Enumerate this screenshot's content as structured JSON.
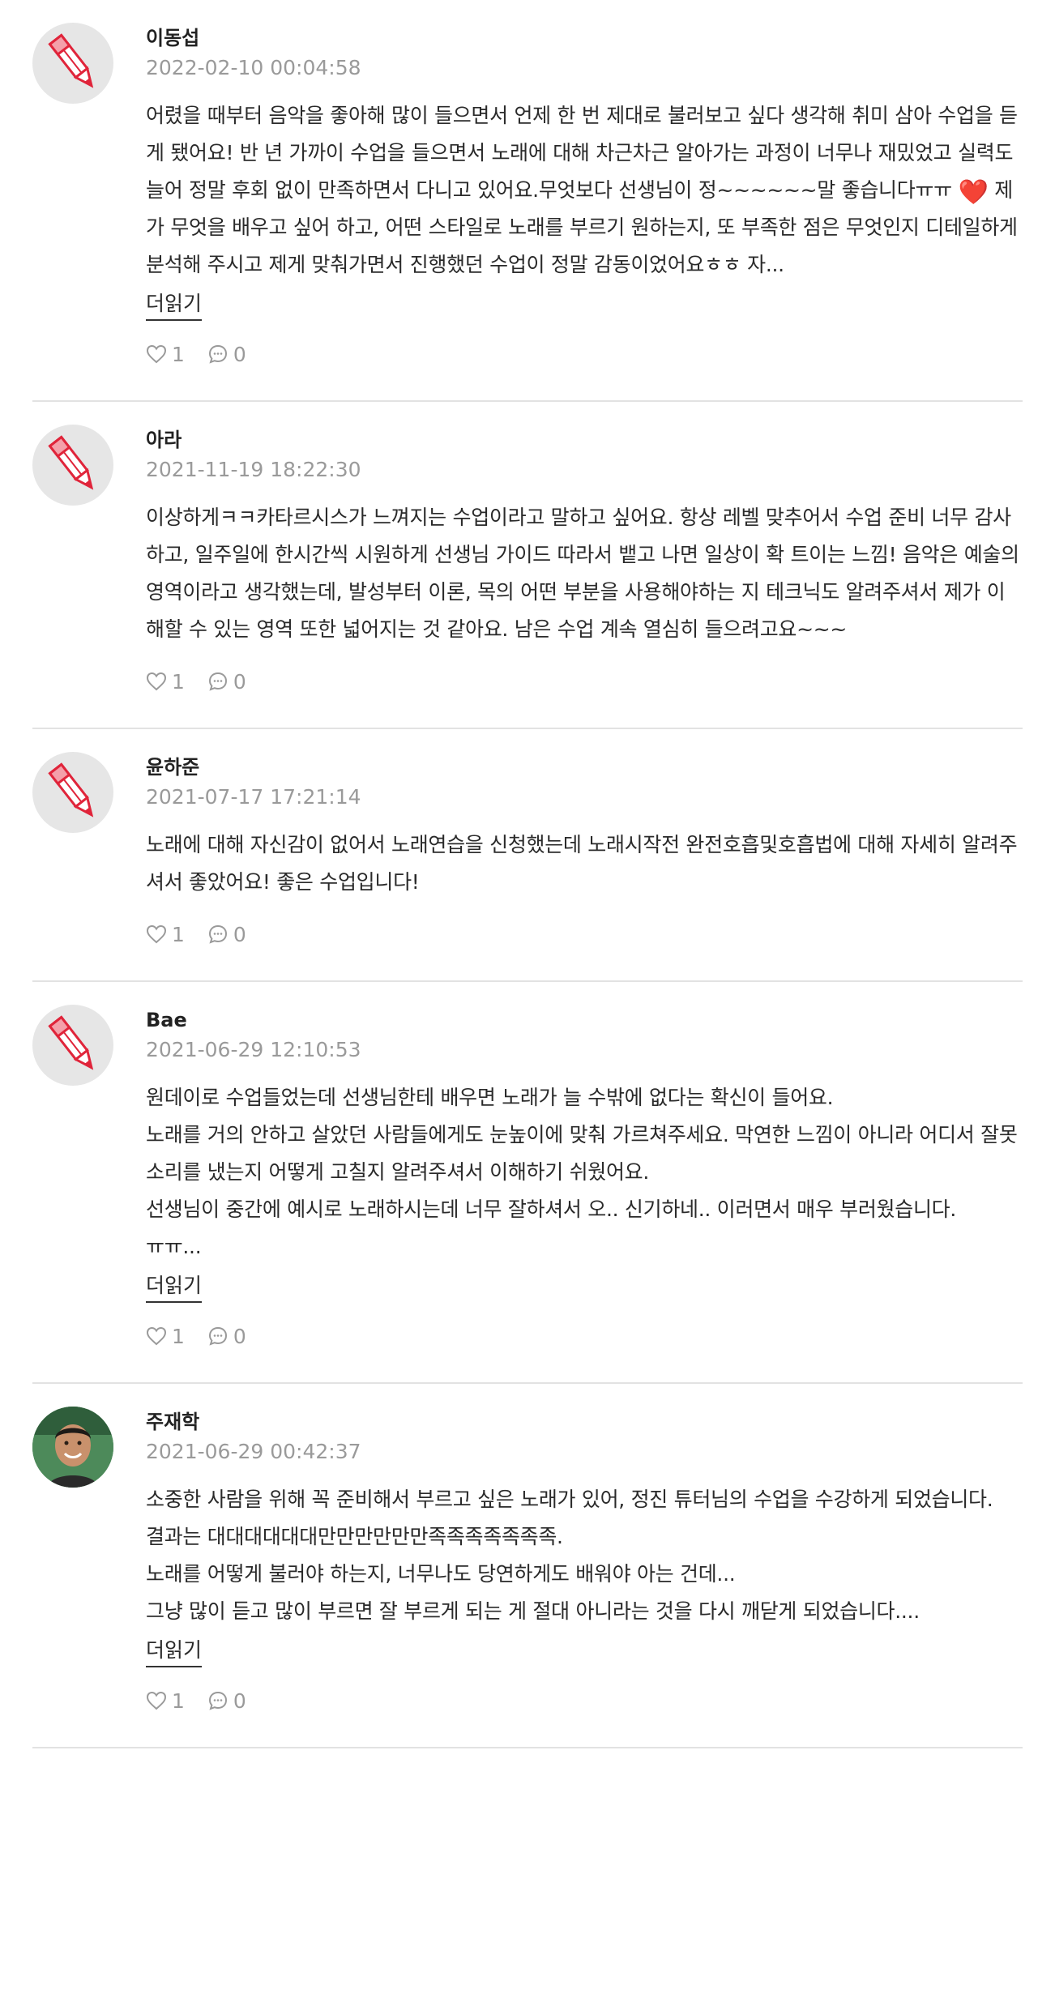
{
  "more_label": "더읽기",
  "reviews": [
    {
      "author": "이동섭",
      "date": "2022-02-10 00:04:58",
      "text_before": "어렸을 때부터 음악을 좋아해 많이 들으면서 언제 한 번 제대로 불러보고 싶다 생각해 취미 삼아 수업을 듣게 됐어요! 반 년 가까이 수업을 들으면서 노래에 대해 차근차근 알아가는 과정이 너무나 재밌었고 실력도 늘어 정말 후회 없이 만족하면서 다니고 있어요.무엇보다 선생님이 정~~~~~~말 좋습니다ㅠㅠ ",
      "emoji": "❤️",
      "text_after": " 제가 무엇을 배우고 싶어 하고, 어떤 스타일로 노래를 부르기 원하는지, 또 부족한 점은 무엇인지 디테일하게 분석해 주시고 제게 맞춰가면서 진행했던 수업이 정말 감동이었어요ㅎㅎ 자...",
      "likes": "1",
      "comments": "0",
      "avatar": "pencil-icon"
    },
    {
      "author": "아라",
      "date": "2021-11-19 18:22:30",
      "text": "이상하게ㅋㅋ카타르시스가 느껴지는 수업이라고 말하고 싶어요. 항상 레벨 맞추어서 수업 준비 너무 감사하고, 일주일에 한시간씩 시원하게 선생님 가이드 따라서 뱉고 나면 일상이 확 트이는 느낌! 음악은 예술의 영역이라고 생각했는데, 발성부터 이론, 목의 어떤 부분을 사용해야하는 지 테크닉도 알려주셔서 제가 이해할 수 있는 영역 또한 넓어지는 것 같아요. 남은 수업 계속 열심히 들으려고요~~~",
      "likes": "1",
      "comments": "0",
      "avatar": "pencil-icon"
    },
    {
      "author": "윤하준",
      "date": "2021-07-17 17:21:14",
      "text": "노래에 대해 자신감이 없어서 노래연습을 신청했는데 노래시작전 완전호흡및호흡법에 대해 자세히 알려주셔서 좋았어요! 좋은 수업입니다!",
      "likes": "1",
      "comments": "0",
      "avatar": "pencil-icon"
    },
    {
      "author": "Bae",
      "date": "2021-06-29 12:10:53",
      "text": "원데이로 수업들었는데 선생님한테 배우면 노래가 늘 수밖에 없다는 확신이 들어요.\n노래를 거의 안하고 살았던 사람들에게도 눈높이에 맞춰 가르쳐주세요. 막연한 느낌이 아니라 어디서 잘못 소리를 냈는지 어떻게 고칠지 알려주셔서 이해하기 쉬웠어요.\n선생님이 중간에 예시로 노래하시는데 너무 잘하셔서 오.. 신기하네.. 이러면서 매우 부러웠습니다.\nㅠㅠ...",
      "likes": "1",
      "comments": "0",
      "avatar": "pencil-icon"
    },
    {
      "author": "주재학",
      "date": "2021-06-29 00:42:37",
      "text": "소중한 사람을 위해 꼭 준비해서 부르고 싶은 노래가 있어, 정진 튜터님의 수업을 수강하게 되었습니다.\n결과는 대대대대대대만만만만만만족족족족족족족.\n노래를 어떻게 불러야 하는지, 너무나도 당연하게도 배워야 아는 건데...\n그냥 많이 듣고 많이 부르면 잘 부르게 되는 게 절대 아니라는 것을 다시 깨닫게 되었습니다....",
      "likes": "1",
      "comments": "0",
      "avatar": "profile-photo"
    }
  ]
}
